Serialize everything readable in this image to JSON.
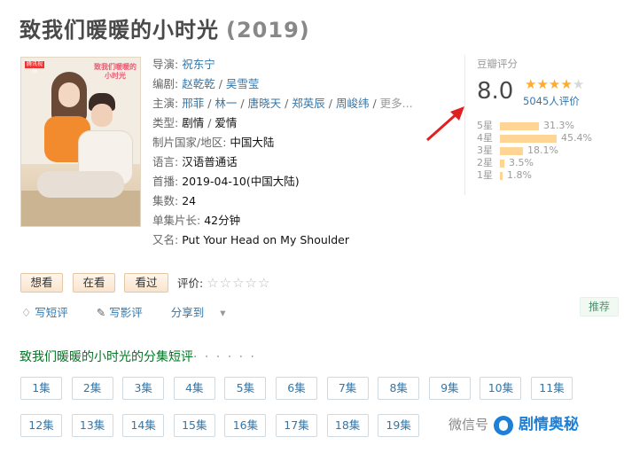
{
  "title": {
    "name": "致我们暖暖的小时光",
    "year": "(2019)"
  },
  "poster": {
    "text": "致我们暖暖的小时光",
    "logo": "腾讯视频"
  },
  "info": {
    "director": {
      "label": "导演",
      "values": [
        "祝东宁"
      ]
    },
    "writer": {
      "label": "编剧",
      "values": [
        "赵乾乾",
        "吴雪莹"
      ]
    },
    "cast": {
      "label": "主演",
      "values": [
        "邢菲",
        "林一",
        "唐晓天",
        "郑英辰",
        "周峻纬"
      ],
      "more": "更多..."
    },
    "genre": {
      "label": "类型",
      "values": [
        "剧情",
        "爱情"
      ]
    },
    "country": {
      "label": "制片国家/地区",
      "value": "中国大陆"
    },
    "language": {
      "label": "语言",
      "value": "汉语普通话"
    },
    "premiere": {
      "label": "首播",
      "value": "2019-04-10(中国大陆)"
    },
    "episodes": {
      "label": "集数",
      "value": "24"
    },
    "duration": {
      "label": "单集片长",
      "value": "42分钟"
    },
    "aka": {
      "label": "又名",
      "value": "Put Your Head on My Shoulder"
    }
  },
  "rating": {
    "title": "豆瓣评分",
    "score": "8.0",
    "stars": 4,
    "votes": "5045人评价",
    "distribution": [
      {
        "label": "5星",
        "percent": "31.3%",
        "value": 31.3
      },
      {
        "label": "4星",
        "percent": "45.4%",
        "value": 45.4
      },
      {
        "label": "3星",
        "percent": "18.1%",
        "value": 18.1
      },
      {
        "label": "2星",
        "percent": "3.5%",
        "value": 3.5
      },
      {
        "label": "1星",
        "percent": "1.8%",
        "value": 1.8
      }
    ],
    "arrow_color": "#e02020"
  },
  "buttons": {
    "want": "想看",
    "watching": "在看",
    "watched": "看过"
  },
  "evaluate": {
    "label": "评价:",
    "stars": "☆☆☆☆☆"
  },
  "actions": {
    "short_review": "写短评",
    "review": "写影评",
    "share": "分享到"
  },
  "recommend": "推荐",
  "episode_section": {
    "title": "致我们暖暖的小时光的分集短评",
    "dots": "· · · · · ·"
  },
  "episodes_row1": [
    "1集",
    "2集",
    "3集",
    "4集",
    "5集",
    "6集",
    "7集",
    "8集",
    "9集",
    "10集",
    "11集"
  ],
  "episodes_row2": [
    "12集",
    "13集",
    "14集",
    "15集",
    "16集",
    "17集",
    "18集",
    "19集"
  ],
  "watermark": {
    "prefix": "微信号",
    "brand": "剧情奥秘"
  }
}
